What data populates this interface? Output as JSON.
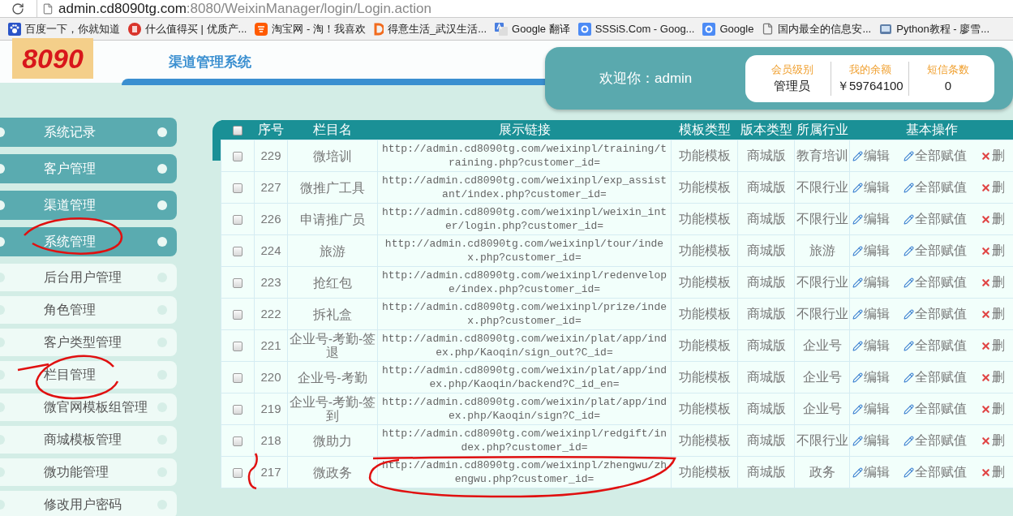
{
  "browser": {
    "url_host": "admin.cd8090tg.com",
    "url_path": ":8080/WeixinManager/login/Login.action",
    "bookmarks": [
      {
        "label": "百度一下，你就知道",
        "kind": "paw"
      },
      {
        "label": "什么值得买 | 优质产...",
        "kind": "seal"
      },
      {
        "label": "淘宝网 - 淘！我喜欢",
        "kind": "taobao"
      },
      {
        "label": "得意生活_武汉生活...",
        "kind": "ribbon"
      },
      {
        "label": "Google 翻译",
        "kind": "translate"
      },
      {
        "label": "SSSiS.Com - Goog...",
        "kind": "square"
      },
      {
        "label": "Google",
        "kind": "square"
      },
      {
        "label": "国内最全的信息安...",
        "kind": "page"
      },
      {
        "label": "Python教程 - 廖雪...",
        "kind": "app"
      }
    ]
  },
  "header": {
    "logo_text": "8090",
    "title": "渠道管理系统",
    "welcome": "欢迎你：admin",
    "stats": [
      {
        "label": "会员级别",
        "value": "管理员"
      },
      {
        "label": "我的余额",
        "value": "￥59764100"
      },
      {
        "label": "短信条数",
        "value": "0"
      }
    ]
  },
  "sidebar": {
    "items": [
      {
        "label": "系统记录",
        "kind": "section"
      },
      {
        "label": "客户管理",
        "kind": "section"
      },
      {
        "label": "渠道管理",
        "kind": "section"
      },
      {
        "label": "系统管理",
        "kind": "section"
      },
      {
        "label": "后台用户管理",
        "kind": "sub"
      },
      {
        "label": "角色管理",
        "kind": "sub"
      },
      {
        "label": "客户类型管理",
        "kind": "sub"
      },
      {
        "label": "栏目管理",
        "kind": "sub"
      },
      {
        "label": "微官网模板组管理",
        "kind": "sub"
      },
      {
        "label": "商城模板管理",
        "kind": "sub"
      },
      {
        "label": "微功能管理",
        "kind": "sub"
      },
      {
        "label": "修改用户密码",
        "kind": "sub"
      }
    ]
  },
  "table": {
    "all_checked": false,
    "columns": [
      "序号",
      "栏目名",
      "展示链接",
      "模板类型",
      "版本类型",
      "所属行业",
      "基本操作"
    ],
    "rows": [
      {
        "checked": false,
        "id": "229",
        "name": "微培训",
        "link": "http://admin.cd8090tg.com/weixinpl/training/training.php?customer_id=",
        "template": "功能模板",
        "edition": "商城版",
        "industry": "教育培训",
        "actions": [
          {
            "label": "编辑",
            "kind": "edit"
          },
          {
            "label": "全部赋值",
            "kind": "edit"
          },
          {
            "label": "删",
            "kind": "delete"
          }
        ]
      },
      {
        "checked": false,
        "id": "227",
        "name": "微推广工具",
        "link": "http://admin.cd8090tg.com/weixinpl/exp_assistant/index.php?customer_id=",
        "template": "功能模板",
        "edition": "商城版",
        "industry": "不限行业",
        "actions": [
          {
            "label": "编辑",
            "kind": "edit"
          },
          {
            "label": "全部赋值",
            "kind": "edit"
          },
          {
            "label": "删",
            "kind": "delete"
          }
        ]
      },
      {
        "checked": false,
        "id": "226",
        "name": "申请推广员",
        "link": "http://admin.cd8090tg.com/weixinpl/weixin_inter/login.php?customer_id=",
        "template": "功能模板",
        "edition": "商城版",
        "industry": "不限行业",
        "actions": [
          {
            "label": "编辑",
            "kind": "edit"
          },
          {
            "label": "全部赋值",
            "kind": "edit"
          },
          {
            "label": "删",
            "kind": "delete"
          }
        ]
      },
      {
        "checked": false,
        "id": "224",
        "name": "旅游",
        "link": "http://admin.cd8090tg.com/weixinpl/tour/index.php?customer_id=",
        "template": "功能模板",
        "edition": "商城版",
        "industry": "旅游",
        "actions": [
          {
            "label": "编辑",
            "kind": "edit"
          },
          {
            "label": "全部赋值",
            "kind": "edit"
          },
          {
            "label": "删",
            "kind": "delete"
          }
        ]
      },
      {
        "checked": false,
        "id": "223",
        "name": "抢红包",
        "link": "http://admin.cd8090tg.com/weixinpl/redenvelope/index.php?customer_id=",
        "template": "功能模板",
        "edition": "商城版",
        "industry": "不限行业",
        "actions": [
          {
            "label": "编辑",
            "kind": "edit"
          },
          {
            "label": "全部赋值",
            "kind": "edit"
          },
          {
            "label": "删",
            "kind": "delete"
          }
        ]
      },
      {
        "checked": false,
        "id": "222",
        "name": "拆礼盒",
        "link": "http://admin.cd8090tg.com/weixinpl/prize/index.php?customer_id=",
        "template": "功能模板",
        "edition": "商城版",
        "industry": "不限行业",
        "actions": [
          {
            "label": "编辑",
            "kind": "edit"
          },
          {
            "label": "全部赋值",
            "kind": "edit"
          },
          {
            "label": "删",
            "kind": "delete"
          }
        ]
      },
      {
        "checked": false,
        "id": "221",
        "name": "企业号-考勤-签退",
        "link": "http://admin.cd8090tg.com/weixin/plat/app/index.php/Kaoqin/sign_out?C_id=",
        "template": "功能模板",
        "edition": "商城版",
        "industry": "企业号",
        "actions": [
          {
            "label": "编辑",
            "kind": "edit"
          },
          {
            "label": "全部赋值",
            "kind": "edit"
          },
          {
            "label": "删",
            "kind": "delete"
          }
        ]
      },
      {
        "checked": false,
        "id": "220",
        "name": "企业号-考勤",
        "link": "http://admin.cd8090tg.com/weixin/plat/app/index.php/Kaoqin/backend?C_id_en=",
        "template": "功能模板",
        "edition": "商城版",
        "industry": "企业号",
        "actions": [
          {
            "label": "编辑",
            "kind": "edit"
          },
          {
            "label": "全部赋值",
            "kind": "edit"
          },
          {
            "label": "删",
            "kind": "delete"
          }
        ]
      },
      {
        "checked": false,
        "id": "219",
        "name": "企业号-考勤-签到",
        "link": "http://admin.cd8090tg.com/weixin/plat/app/index.php/Kaoqin/sign?C_id=",
        "template": "功能模板",
        "edition": "商城版",
        "industry": "企业号",
        "actions": [
          {
            "label": "编辑",
            "kind": "edit"
          },
          {
            "label": "全部赋值",
            "kind": "edit"
          },
          {
            "label": "删",
            "kind": "delete"
          }
        ]
      },
      {
        "checked": false,
        "id": "218",
        "name": "微助力",
        "link": "http://admin.cd8090tg.com/weixinpl/redgift/index.php?customer_id=",
        "template": "功能模板",
        "edition": "商城版",
        "industry": "不限行业",
        "actions": [
          {
            "label": "编辑",
            "kind": "edit"
          },
          {
            "label": "全部赋值",
            "kind": "edit"
          },
          {
            "label": "删",
            "kind": "delete"
          }
        ]
      },
      {
        "checked": false,
        "id": "217",
        "name": "微政务",
        "link": "http://admin.cd8090tg.com/weixinpl/zhengwu/zhengwu.php?customer_id=",
        "template": "功能模板",
        "edition": "商城版",
        "industry": "政务",
        "actions": [
          {
            "label": "编辑",
            "kind": "edit"
          },
          {
            "label": "全部赋值",
            "kind": "edit"
          },
          {
            "label": "删",
            "kind": "delete"
          }
        ]
      }
    ]
  }
}
